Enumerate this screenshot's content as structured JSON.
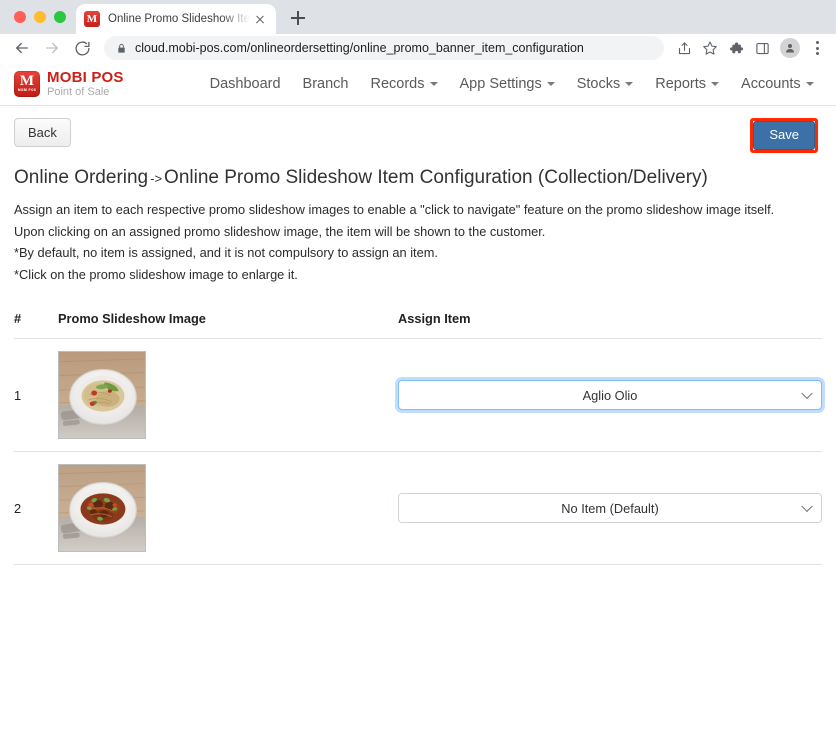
{
  "browser": {
    "tab": {
      "title": "Online Promo Slideshow Item C",
      "favicon_letter": "M",
      "favicon_name": "mobi-pos-favicon",
      "close_label": "×"
    },
    "new_tab_label": "+",
    "nav": {
      "back_icon": "arrow-left-icon",
      "forward_icon": "arrow-right-icon",
      "reload_icon": "reload-icon"
    },
    "omnibox": {
      "lock_icon": "lock-icon",
      "url": "cloud.mobi-pos.com/onlineordersetting/online_promo_banner_item_configuration"
    },
    "toolbar_icons": [
      "share-icon",
      "bookmark-star-icon",
      "extensions-puzzle-icon",
      "side-panel-icon",
      "profile-avatar-icon",
      "chrome-menu-kebab-icon"
    ]
  },
  "site_nav": {
    "brand": {
      "mark_letter": "M",
      "mark_sub": "MOBI POS",
      "title": "MOBI POS",
      "subtitle": "Point of Sale"
    },
    "links": [
      {
        "label": "Dashboard",
        "has_caret": false
      },
      {
        "label": "Branch",
        "has_caret": false
      },
      {
        "label": "Records",
        "has_caret": true
      },
      {
        "label": "App Settings",
        "has_caret": true
      },
      {
        "label": "Stocks",
        "has_caret": true
      },
      {
        "label": "Reports",
        "has_caret": true
      },
      {
        "label": "Accounts",
        "has_caret": true
      }
    ]
  },
  "toolbar": {
    "back_label": "Back",
    "save_label": "Save",
    "save_highlight_color": "#ff2a00",
    "save_button_color": "#3b71a7"
  },
  "heading": {
    "prefix": "Online Ordering",
    "arrow": "->",
    "suffix": "Online Promo Slideshow Item Configuration (Collection/Delivery)"
  },
  "description": [
    "Assign an item to each respective promo slideshow images to enable a \"click to navigate\" feature on the promo slideshow image itself.",
    "Upon clicking on an assigned promo slideshow image, the item will be shown to the customer.",
    "*By default, no item is assigned, and it is not compulsory to assign an item.",
    "*Click on the promo slideshow image to enlarge it."
  ],
  "table": {
    "headers": {
      "num": "#",
      "image": "Promo Slideshow Image",
      "item": "Assign Item"
    },
    "rows": [
      {
        "num": "1",
        "image_alt": "pasta-aglio-olio-thumbnail",
        "selected_item": "Aglio Olio",
        "focused": true
      },
      {
        "num": "2",
        "image_alt": "meatball-pasta-thumbnail",
        "selected_item": "No Item (Default)",
        "focused": false
      }
    ]
  }
}
